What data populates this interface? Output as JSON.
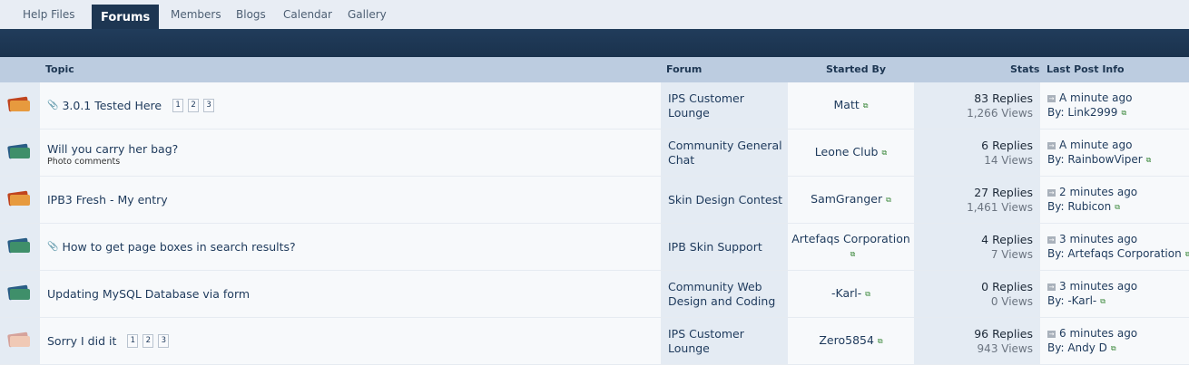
{
  "nav": {
    "tabs": [
      {
        "label": "Help Files",
        "active": false
      },
      {
        "label": "Forums",
        "active": true
      },
      {
        "label": "Members",
        "active": false
      },
      {
        "label": "Blogs",
        "active": false
      },
      {
        "label": "Calendar",
        "active": false
      },
      {
        "label": "Gallery",
        "active": false
      }
    ]
  },
  "table": {
    "headers": {
      "topic": "Topic",
      "forum": "Forum",
      "started_by": "Started By",
      "stats": "Stats",
      "last_post": "Last Post Info"
    },
    "rows": [
      {
        "icon": "hot-topic-folder-icon",
        "pinned": true,
        "title": "3.0.1 Tested Here",
        "description": "",
        "pages": [
          "1",
          "2",
          "3"
        ],
        "forum": "IPS Customer Lounge",
        "starter": "Matt",
        "replies": "83 Replies",
        "views": "1,266 Views",
        "last_time": "A minute ago",
        "last_by": "By: Link2999"
      },
      {
        "icon": "topic-folder-icon",
        "pinned": false,
        "title": "Will you carry her bag?",
        "description": "Photo comments",
        "pages": [],
        "forum": "Community General Chat",
        "starter": "Leone Club",
        "replies": "6 Replies",
        "views": "14 Views",
        "last_time": "A minute ago",
        "last_by": "By: RainbowViper"
      },
      {
        "icon": "hot-topic-folder-icon",
        "pinned": false,
        "title": "IPB3 Fresh - My entry",
        "description": "",
        "pages": [],
        "forum": "Skin Design Contest",
        "starter": "SamGranger",
        "replies": "27 Replies",
        "views": "1,461 Views",
        "last_time": "2 minutes ago",
        "last_by": "By: Rubicon"
      },
      {
        "icon": "topic-folder-icon",
        "pinned": true,
        "title": "How to get page boxes in search results?",
        "description": "",
        "pages": [],
        "forum": "IPB Skin Support",
        "starter": "Artefaqs Corporation",
        "replies": "4 Replies",
        "views": "7 Views",
        "last_time": "3 minutes ago",
        "last_by": "By: Artefaqs Corporation"
      },
      {
        "icon": "topic-folder-icon",
        "pinned": false,
        "title": "Updating MySQL Database via form",
        "description": "",
        "pages": [],
        "forum": "Community Web Design and Coding",
        "starter": "-Karl-",
        "replies": "0 Replies",
        "views": "0 Views",
        "last_time": "3 minutes ago",
        "last_by": "By: -Karl-"
      },
      {
        "icon": "read-hot-topic-folder-icon",
        "pinned": false,
        "title": "Sorry I did it",
        "description": "",
        "pages": [
          "1",
          "2",
          "3"
        ],
        "forum": "IPS Customer Lounge",
        "starter": "Zero5854",
        "replies": "96 Replies",
        "views": "943 Views",
        "last_time": "6 minutes ago",
        "last_by": "By: Andy D"
      }
    ]
  },
  "colors": {
    "nav_bg": "#e8edf4",
    "active_tab": "#1d3652",
    "band": "#1f3a59",
    "header_bg": "#bccce0",
    "hot_back": "#c0451e",
    "hot_front": "#e79a3e",
    "cold_back": "#2a5e86",
    "cold_front": "#3f8f6a",
    "read_back": "#d6a39b",
    "read_front": "#f0c9b5"
  }
}
